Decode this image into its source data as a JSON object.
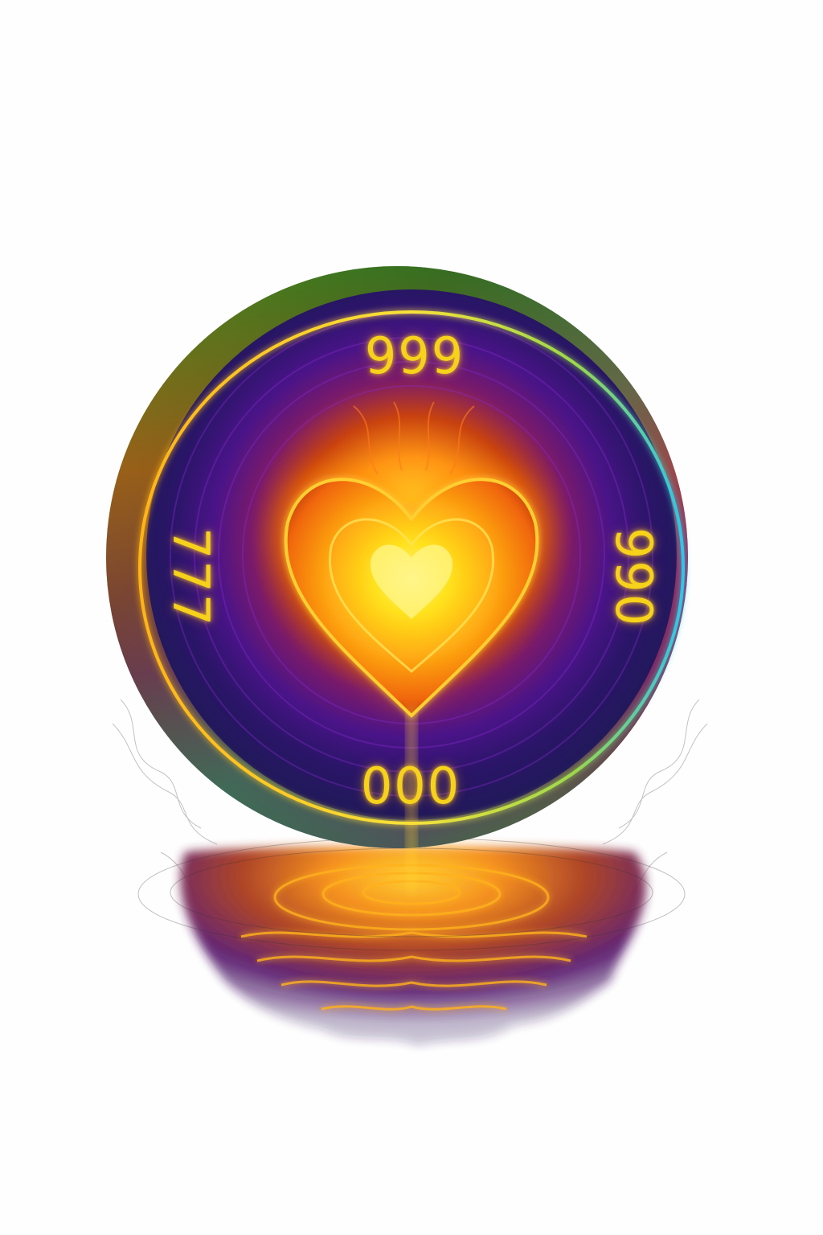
{
  "numbers": {
    "top": "999",
    "left": "777",
    "right": "990",
    "bottom": "000"
  },
  "icons": {
    "central": "heart-icon",
    "ring": "ring-icon",
    "reflection": "water-ripple-icon"
  },
  "colors": {
    "ring_outer_green": "#3f8a1e",
    "ring_outer_orange": "#f07a10",
    "ring_outer_cyan": "#1aa6c8",
    "ring_body_indigo": "#2c1670",
    "ring_body_purple": "#6a1aa0",
    "heart_glow_yellow": "#ffe23a",
    "heart_orange": "#ff8a12",
    "number_gold": "#f6d21a",
    "background": "#fefefe"
  }
}
